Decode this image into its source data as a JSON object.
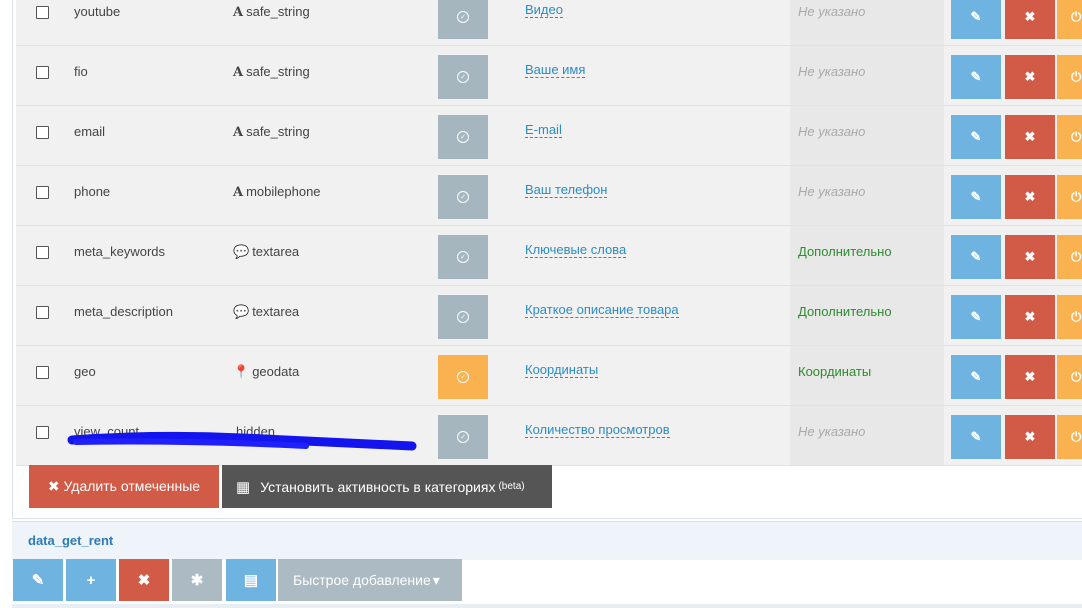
{
  "rows": [
    {
      "name": "youtube",
      "type_icon": "A",
      "type": "safe_string",
      "active": false,
      "title": "Видео",
      "tab": "Не указано",
      "tab_style": "none"
    },
    {
      "name": "fio",
      "type_icon": "A",
      "type": "safe_string",
      "active": false,
      "title": "Ваше имя",
      "tab": "Не указано",
      "tab_style": "none"
    },
    {
      "name": "email",
      "type_icon": "A",
      "type": "safe_string",
      "active": false,
      "title": "E-mail",
      "tab": "Не указано",
      "tab_style": "none"
    },
    {
      "name": "phone",
      "type_icon": "A",
      "type": "mobilephone",
      "active": false,
      "title": "Ваш телефон",
      "tab": "Не указано",
      "tab_style": "none"
    },
    {
      "name": "meta_keywords",
      "type_icon": "💬",
      "type": "textarea",
      "active": false,
      "title": "Ключевые слова",
      "tab": "Дополнительно",
      "tab_style": "green"
    },
    {
      "name": "meta_description",
      "type_icon": "💬",
      "type": "textarea",
      "active": false,
      "title": "Краткое описание товара",
      "tab": "Дополнительно",
      "tab_style": "green"
    },
    {
      "name": "geo",
      "type_icon": "📍",
      "type": "geodata",
      "active": true,
      "title": "Координаты",
      "tab": "Координаты",
      "tab_style": "green"
    },
    {
      "name": "view_count",
      "type_icon": "",
      "type": "hidden",
      "active": false,
      "title": "Количество просмотров",
      "tab": "Не указано",
      "tab_style": "none"
    }
  ],
  "icons": {
    "edit": "✎",
    "delete": "✖",
    "power": "⏻",
    "check": "✓",
    "grid": "▦",
    "plus": "+",
    "asterisk": "✱",
    "list": "▤",
    "caret": "▾"
  },
  "bulk": {
    "delete_label": "✖ Удалить отмеченные",
    "activity_label": "Установить активность в категориях",
    "activity_sup": "(beta)"
  },
  "section": {
    "title": "data_get_rent",
    "quick_add": "Быстрое добавление"
  },
  "colors": {
    "blue": "#6fb3e0",
    "red": "#d15b47",
    "orange": "#f9b24f",
    "grey": "#abbac3",
    "link": "#2b8cc4",
    "green": "#2e8b2e"
  }
}
